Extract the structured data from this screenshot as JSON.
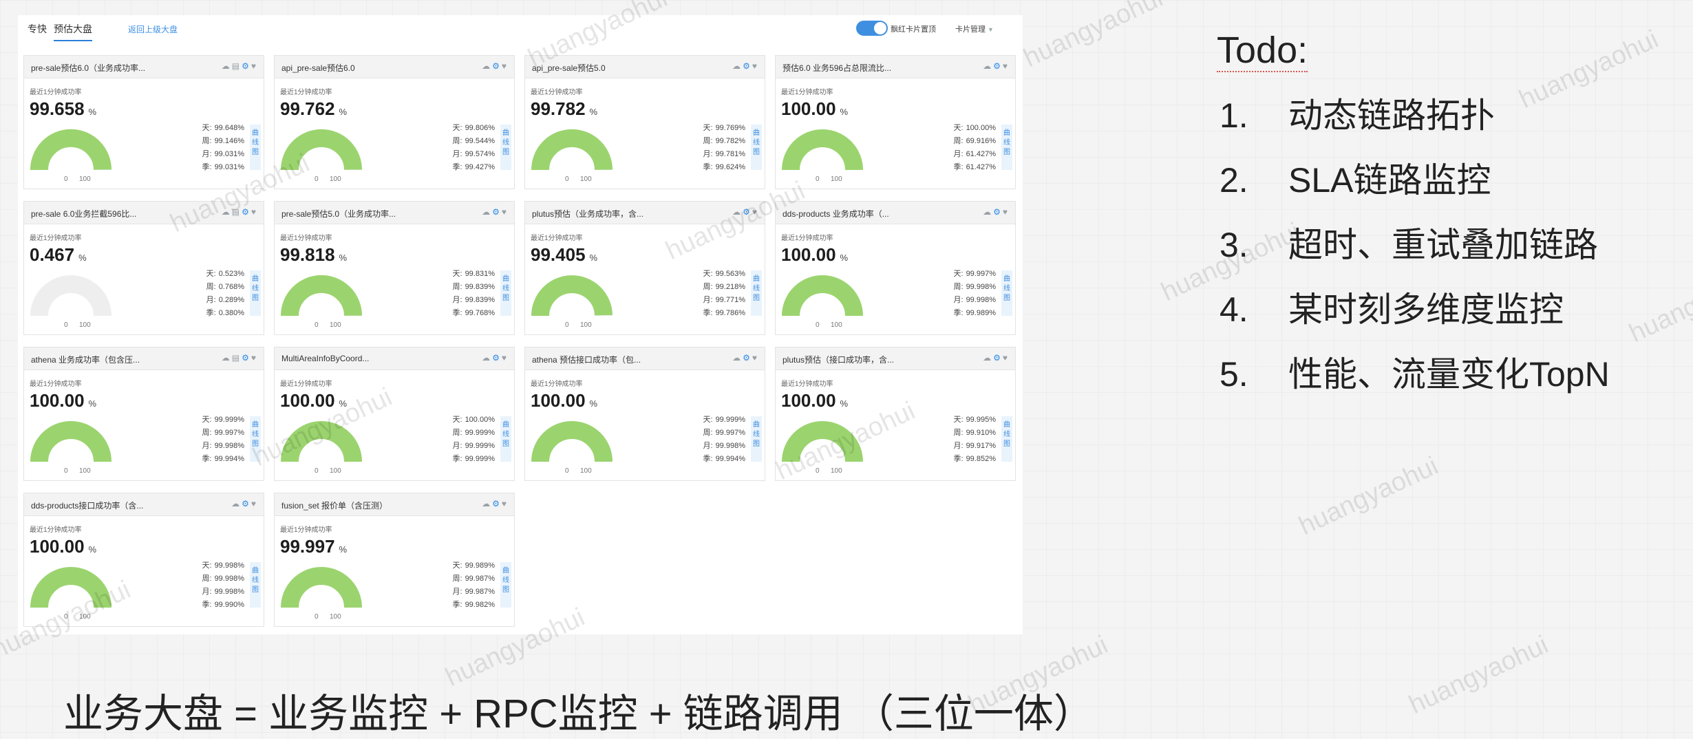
{
  "topbar": {
    "tabs": [
      "专快",
      "预估大盘"
    ],
    "active_tab": 1,
    "back_link": "返回上级大盘",
    "toggle_label": "飘红卡片置顶",
    "card_manage": "卡片管理",
    "accent": "#3f8fe0"
  },
  "gauge_colors": {
    "fill": "#9bd46e",
    "track": "#eeeeee"
  },
  "cards": [
    {
      "title": "pre-sale预估6.0（业务成功率...",
      "icons": "☁ ▤ ⚙ ♥",
      "sub": "最近1分钟成功率",
      "value": "99.658",
      "unit": "%",
      "stats": [
        [
          "天:",
          "99.648%"
        ],
        [
          "周:",
          "99.146%"
        ],
        [
          "月:",
          "99.031%"
        ],
        [
          "季:",
          "99.031%"
        ]
      ],
      "side": "曲线图",
      "fill": 0.99658
    },
    {
      "title": "api_pre-sale预估6.0",
      "icons": "☁ ⚙ ♥",
      "sub": "最近1分钟成功率",
      "value": "99.762",
      "unit": "%",
      "stats": [
        [
          "天:",
          "99.806%"
        ],
        [
          "周:",
          "99.544%"
        ],
        [
          "月:",
          "99.574%"
        ],
        [
          "季:",
          "99.427%"
        ]
      ],
      "side": "曲线图",
      "fill": 0.99762
    },
    {
      "title": "api_pre-sale预估5.0",
      "icons": "☁ ⚙ ♥",
      "sub": "最近1分钟成功率",
      "value": "99.782",
      "unit": "%",
      "stats": [
        [
          "天:",
          "99.769%"
        ],
        [
          "周:",
          "99.782%"
        ],
        [
          "月:",
          "99.781%"
        ],
        [
          "季:",
          "99.624%"
        ]
      ],
      "side": "曲线图",
      "fill": 0.99782
    },
    {
      "title": "预估6.0 业务596占总限流比...",
      "icons": "☁ ⚙ ♥",
      "sub": "最近1分钟成功率",
      "value": "100.00",
      "unit": "%",
      "stats": [
        [
          "天:",
          "100.00%"
        ],
        [
          "周:",
          "69.916%"
        ],
        [
          "月:",
          "61.427%"
        ],
        [
          "季:",
          "61.427%"
        ]
      ],
      "side": "曲线图",
      "fill": 1.0
    },
    {
      "title": "pre-sale 6.0业务拦截596比...",
      "icons": "☁ ▤ ⚙ ♥",
      "sub": "最近1分钟成功率",
      "value": "0.467",
      "unit": "%",
      "stats": [
        [
          "天:",
          "0.523%"
        ],
        [
          "周:",
          "0.768%"
        ],
        [
          "月:",
          "0.289%"
        ],
        [
          "季:",
          "0.380%"
        ]
      ],
      "side": "曲线图",
      "fill": 0.00467
    },
    {
      "title": "pre-sale预估5.0（业务成功率...",
      "icons": "☁ ⚙ ♥",
      "sub": "最近1分钟成功率",
      "value": "99.818",
      "unit": "%",
      "stats": [
        [
          "天:",
          "99.831%"
        ],
        [
          "周:",
          "99.839%"
        ],
        [
          "月:",
          "99.839%"
        ],
        [
          "季:",
          "99.768%"
        ]
      ],
      "side": "曲线图",
      "fill": 0.99818
    },
    {
      "title": "plutus预估（业务成功率，含...",
      "icons": "☁ ⚙ ♥",
      "sub": "最近1分钟成功率",
      "value": "99.405",
      "unit": "%",
      "stats": [
        [
          "天:",
          "99.563%"
        ],
        [
          "周:",
          "99.218%"
        ],
        [
          "月:",
          "99.771%"
        ],
        [
          "季:",
          "99.786%"
        ]
      ],
      "side": "曲线图",
      "fill": 0.99405
    },
    {
      "title": "dds-products 业务成功率（...",
      "icons": "☁ ⚙ ♥",
      "sub": "最近1分钟成功率",
      "value": "100.00",
      "unit": "%",
      "stats": [
        [
          "天:",
          "99.997%"
        ],
        [
          "周:",
          "99.998%"
        ],
        [
          "月:",
          "99.998%"
        ],
        [
          "季:",
          "99.989%"
        ]
      ],
      "side": "曲线图",
      "fill": 1.0
    },
    {
      "title": "athena 业务成功率（包含压...",
      "icons": "☁ ▤ ⚙ ♥",
      "sub": "最近1分钟成功率",
      "value": "100.00",
      "unit": "%",
      "stats": [
        [
          "天:",
          "99.999%"
        ],
        [
          "周:",
          "99.997%"
        ],
        [
          "月:",
          "99.998%"
        ],
        [
          "季:",
          "99.994%"
        ]
      ],
      "side": "曲线图",
      "fill": 1.0
    },
    {
      "title": "MultiAreaInfoByCoord...",
      "icons": "☁ ⚙ ♥",
      "sub": "最近1分钟成功率",
      "value": "100.00",
      "unit": "%",
      "stats": [
        [
          "天:",
          "100.00%"
        ],
        [
          "周:",
          "99.999%"
        ],
        [
          "月:",
          "99.999%"
        ],
        [
          "季:",
          "99.999%"
        ]
      ],
      "side": "曲线图",
      "fill": 1.0
    },
    {
      "title": "athena 预估接口成功率（包...",
      "icons": "☁ ⚙ ♥",
      "sub": "最近1分钟成功率",
      "value": "100.00",
      "unit": "%",
      "stats": [
        [
          "天:",
          "99.999%"
        ],
        [
          "周:",
          "99.997%"
        ],
        [
          "月:",
          "99.998%"
        ],
        [
          "季:",
          "99.994%"
        ]
      ],
      "side": "曲线图",
      "fill": 1.0
    },
    {
      "title": "plutus预估（接口成功率，含...",
      "icons": "☁ ⚙ ♥",
      "sub": "最近1分钟成功率",
      "value": "100.00",
      "unit": "%",
      "stats": [
        [
          "天:",
          "99.995%"
        ],
        [
          "周:",
          "99.910%"
        ],
        [
          "月:",
          "99.917%"
        ],
        [
          "季:",
          "99.852%"
        ]
      ],
      "side": "曲线图",
      "fill": 1.0
    },
    {
      "title": "dds-products接口成功率（含...",
      "icons": "☁ ⚙ ♥",
      "sub": "最近1分钟成功率",
      "value": "100.00",
      "unit": "%",
      "stats": [
        [
          "天:",
          "99.998%"
        ],
        [
          "周:",
          "99.998%"
        ],
        [
          "月:",
          "99.998%"
        ],
        [
          "季:",
          "99.990%"
        ]
      ],
      "side": "曲线图",
      "fill": 1.0
    },
    {
      "title": "fusion_set 报价单（含压测）",
      "icons": "☁ ⚙ ♥",
      "sub": "最近1分钟成功率",
      "value": "99.997",
      "unit": "%",
      "stats": [
        [
          "天:",
          "99.989%"
        ],
        [
          "周:",
          "99.987%"
        ],
        [
          "月:",
          "99.987%"
        ],
        [
          "季:",
          "99.982%"
        ]
      ],
      "side": "曲线图",
      "fill": 0.99997
    }
  ],
  "gauge_scale": [
    "0",
    "100"
  ],
  "todo": {
    "title": "Todo:",
    "items": [
      {
        "num": "1.",
        "text": "动态链路拓扑"
      },
      {
        "num": "2.",
        "text": "SLA链路监控"
      },
      {
        "num": "3.",
        "text": "超时、重试叠加链路"
      },
      {
        "num": "4.",
        "text": "某时刻多维度监控"
      },
      {
        "num": "5.",
        "text": "性能、流量变化TopN"
      }
    ]
  },
  "formula": "业务大盘 = 业务监控 + RPC监控 + 链路调用 （三位一体）",
  "watermark": "huangyaohui"
}
